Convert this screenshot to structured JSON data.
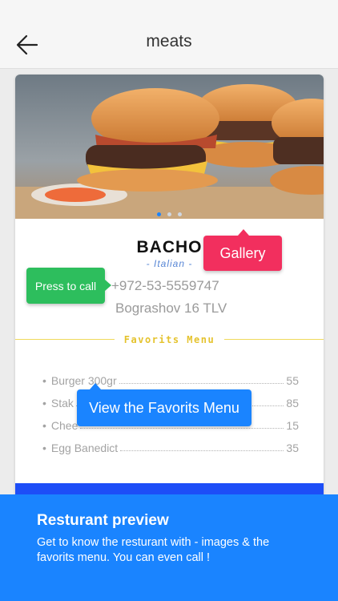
{
  "header": {
    "title": "meats",
    "back_icon": "arrow-left-icon"
  },
  "restaurant": {
    "name": "BACHO",
    "cuisine": "- Italian -",
    "phone": "+972-53-5559747",
    "address": "Bograshov 16 TLV",
    "gallery_dots": 3,
    "active_dot": 0
  },
  "menu": {
    "title": "Favorits Menu",
    "items": [
      {
        "name": "Burger 300gr",
        "price": "55"
      },
      {
        "name": "Stak",
        "price": "85"
      },
      {
        "name": "Chee",
        "price": "15"
      },
      {
        "name": "Egg Banedict",
        "price": "35"
      }
    ]
  },
  "tooltips": {
    "gallery": "Gallery",
    "call": "Press to call",
    "favorites": "View the Favorits Menu"
  },
  "banner": {
    "title": "Resturant preview",
    "description": "Get to know the resturant with - images & the favorits menu. You can even call !"
  },
  "colors": {
    "accent_blue": "#1a84ff",
    "gallery_red": "#f22f5e",
    "call_green": "#2dbe5d",
    "menu_gold": "#e5c32e",
    "card_bottom_blue": "#1d4ef7"
  }
}
